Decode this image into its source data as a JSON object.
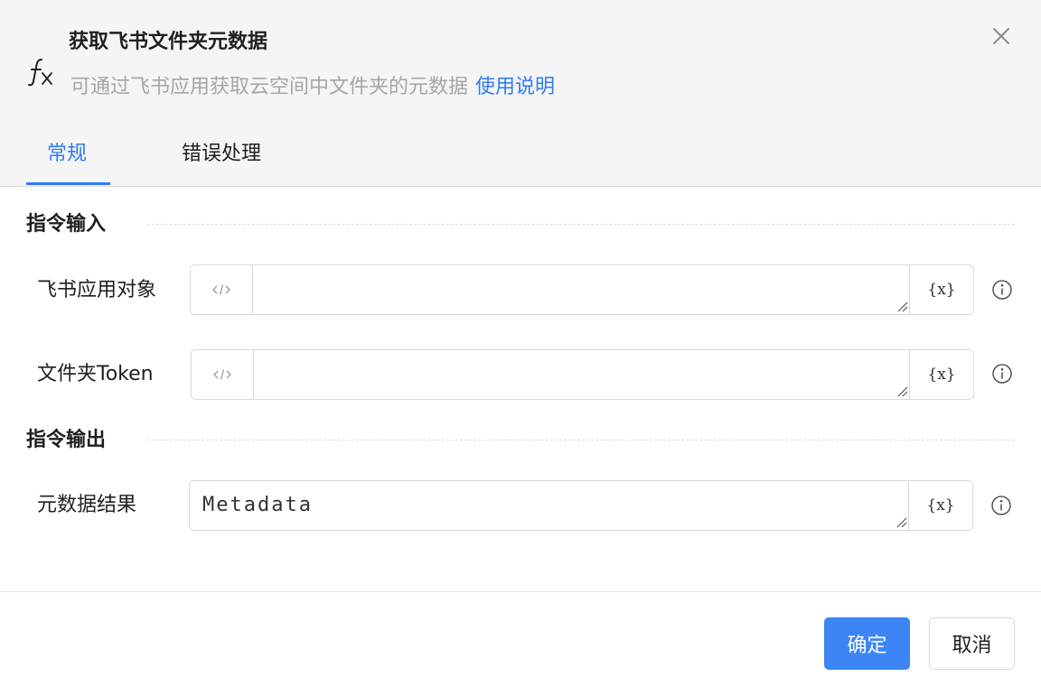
{
  "header": {
    "icon": "fx-function-icon",
    "title": "获取飞书文件夹元数据",
    "subtitle": "可通过飞书应用获取云空间中文件夹的元数据",
    "help_link": "使用说明",
    "close_icon": "close-icon"
  },
  "tabs": [
    {
      "label": "常规",
      "active": true
    },
    {
      "label": "错误处理",
      "active": false
    }
  ],
  "input_section": {
    "title": "指令输入",
    "fields": [
      {
        "label": "飞书应用对象",
        "value": "",
        "var_label": "{x}"
      },
      {
        "label": "文件夹Token",
        "value": "",
        "var_label": "{x}"
      }
    ]
  },
  "output_section": {
    "title": "指令输出",
    "fields": [
      {
        "label": "元数据结果",
        "value": "Metadata",
        "var_label": "{x}"
      }
    ]
  },
  "footer": {
    "confirm_label": "确定",
    "cancel_label": "取消"
  },
  "colors": {
    "accent": "#2f7bf5",
    "primary_button": "#3d85f5",
    "header_bg": "#f5f5f5",
    "muted_text": "#a6a6a6"
  }
}
